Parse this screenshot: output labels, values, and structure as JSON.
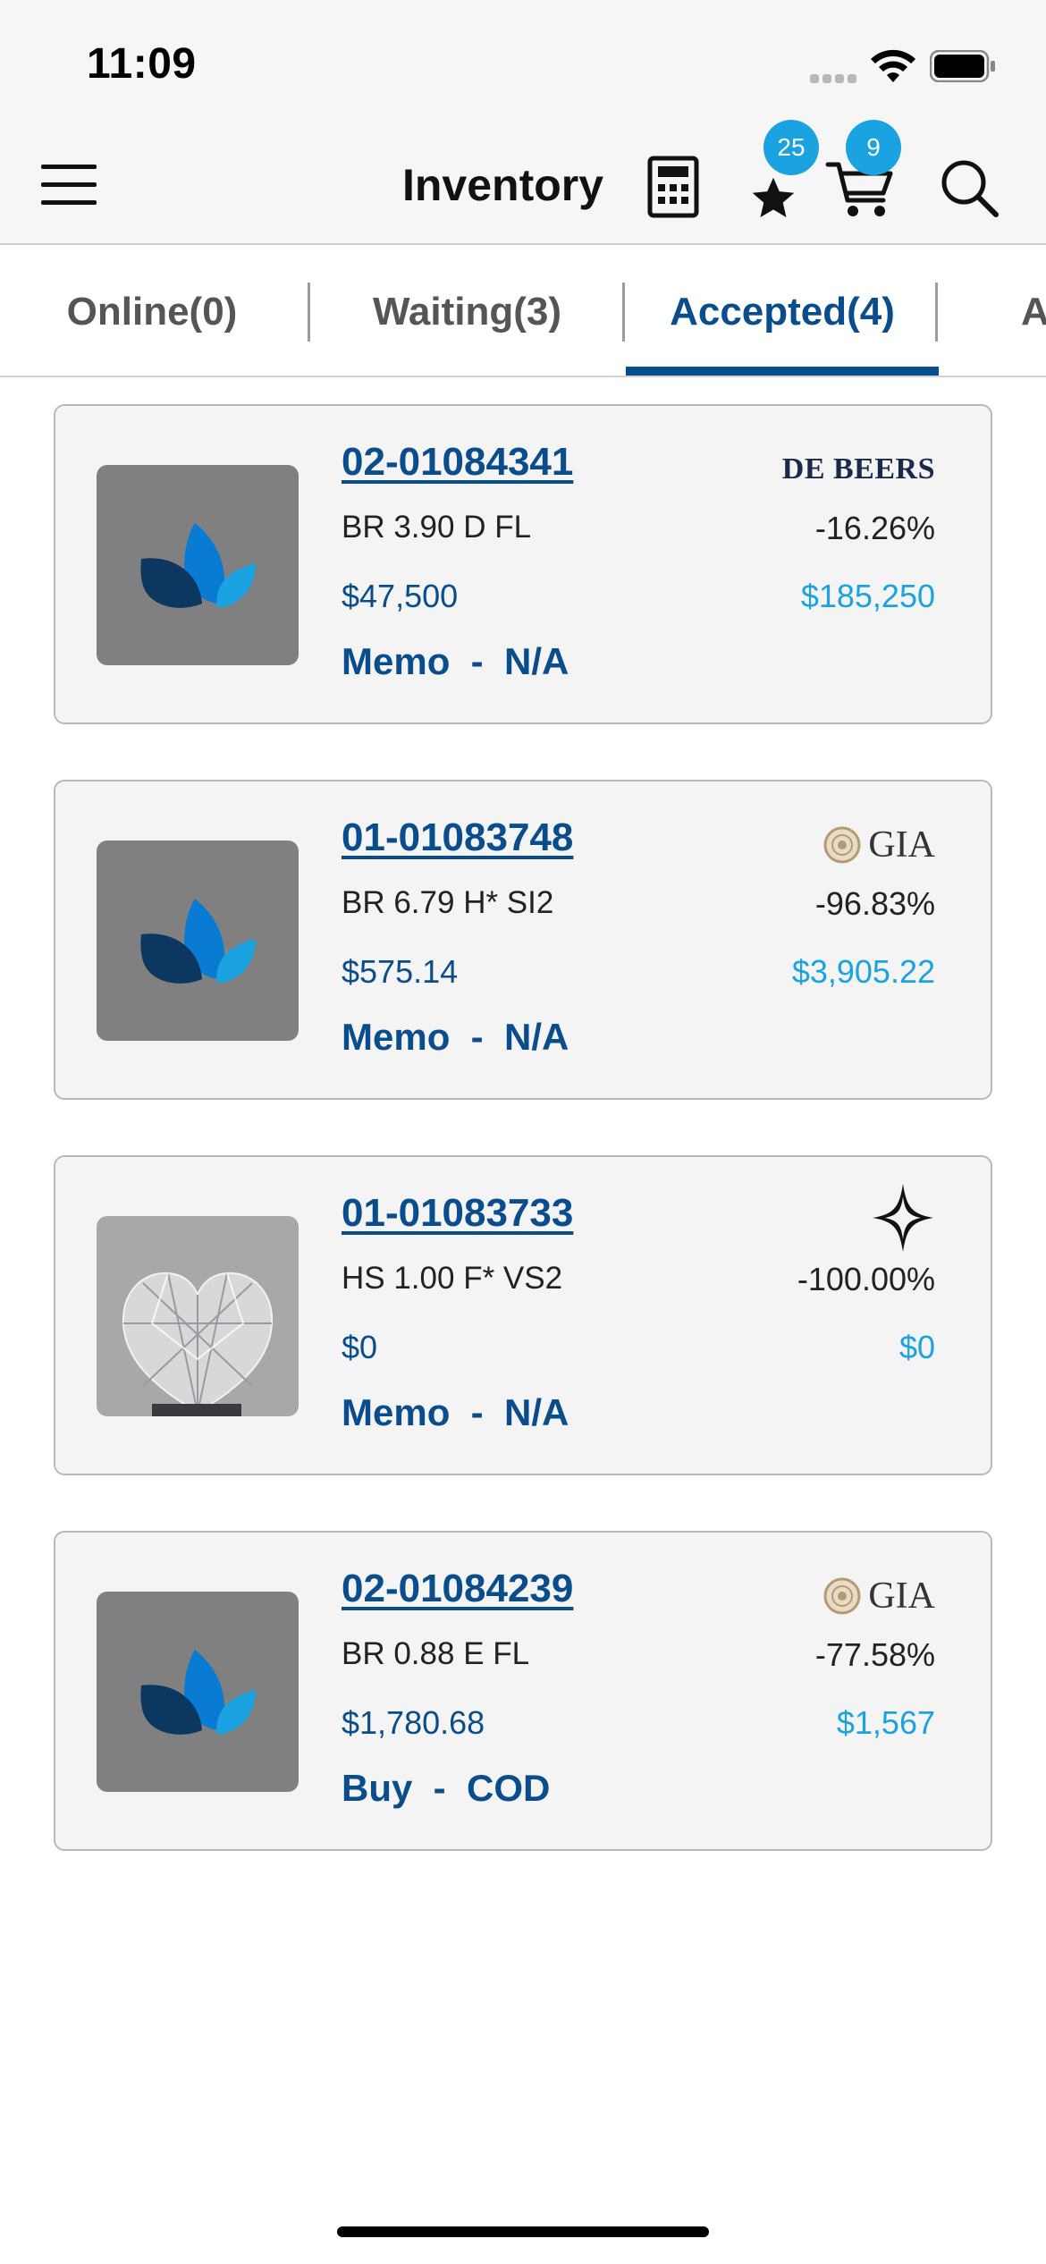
{
  "status_bar": {
    "time": "11:09"
  },
  "header": {
    "title": "Inventory",
    "favorites_count": "25",
    "cart_count": "9",
    "icons": [
      "menu-icon",
      "calculator-icon",
      "star-icon",
      "cart-icon",
      "search-icon"
    ]
  },
  "tabs": [
    {
      "label": "Online(0)",
      "active": false
    },
    {
      "label": "Waiting(3)",
      "active": false
    },
    {
      "label": "Accepted(4)",
      "active": true
    },
    {
      "label": "A",
      "active": false
    }
  ],
  "colors": {
    "primary": "#0a4d8c",
    "accent": "#1aa3e0",
    "card_bg": "#f4f4f4"
  },
  "items": [
    {
      "stock_id": "02-01084341",
      "lab": "DE BEERS",
      "specs": "BR 3.90 D FL",
      "discount": "-16.26%",
      "price": "$47,500",
      "total": "$185,250",
      "terms": "Memo  -  N/A",
      "image": "placeholder-logo"
    },
    {
      "stock_id": "01-01083748",
      "lab": "GIA",
      "specs": "BR 6.79 H* SI2",
      "discount": "-96.83%",
      "price": "$575.14",
      "total": "$3,905.22",
      "terms": "Memo  -  N/A",
      "image": "placeholder-logo"
    },
    {
      "stock_id": "01-01083733",
      "lab": "diamond-star-logo",
      "specs": "HS 1.00 F* VS2",
      "discount": "-100.00%",
      "price": "$0",
      "total": "$0",
      "terms": "Memo  -  N/A",
      "image": "heart-diamond-photo"
    },
    {
      "stock_id": "02-01084239",
      "lab": "GIA",
      "specs": "BR 0.88 E FL",
      "discount": "-77.58%",
      "price": "$1,780.68",
      "total": "$1,567",
      "terms": "Buy  -  COD",
      "image": "placeholder-logo"
    }
  ]
}
